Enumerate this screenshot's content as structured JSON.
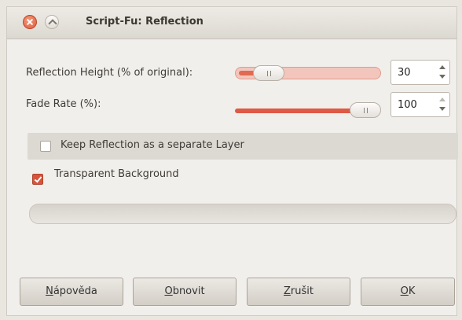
{
  "window": {
    "title": "Script-Fu: Reflection"
  },
  "fields": {
    "height": {
      "label": "Reflection Height (% of original):",
      "value": "30",
      "level_percent": 15
    },
    "fade": {
      "label": "Fade Rate (%):",
      "value": "100",
      "level_percent": 100
    }
  },
  "options": {
    "keep_layer": {
      "label": "Keep Reflection as a separate Layer",
      "checked": false
    },
    "transparent_bg": {
      "label": "Transparent Background",
      "checked": true
    }
  },
  "buttons": {
    "help": {
      "first": "N",
      "rest": "ápověda"
    },
    "reset": {
      "first": "O",
      "rest": "bnovit"
    },
    "cancel": {
      "first": "Z",
      "rest": "rušit"
    },
    "ok": {
      "first": "O",
      "rest": "K"
    }
  },
  "colors": {
    "accent": "#dd5a44"
  }
}
